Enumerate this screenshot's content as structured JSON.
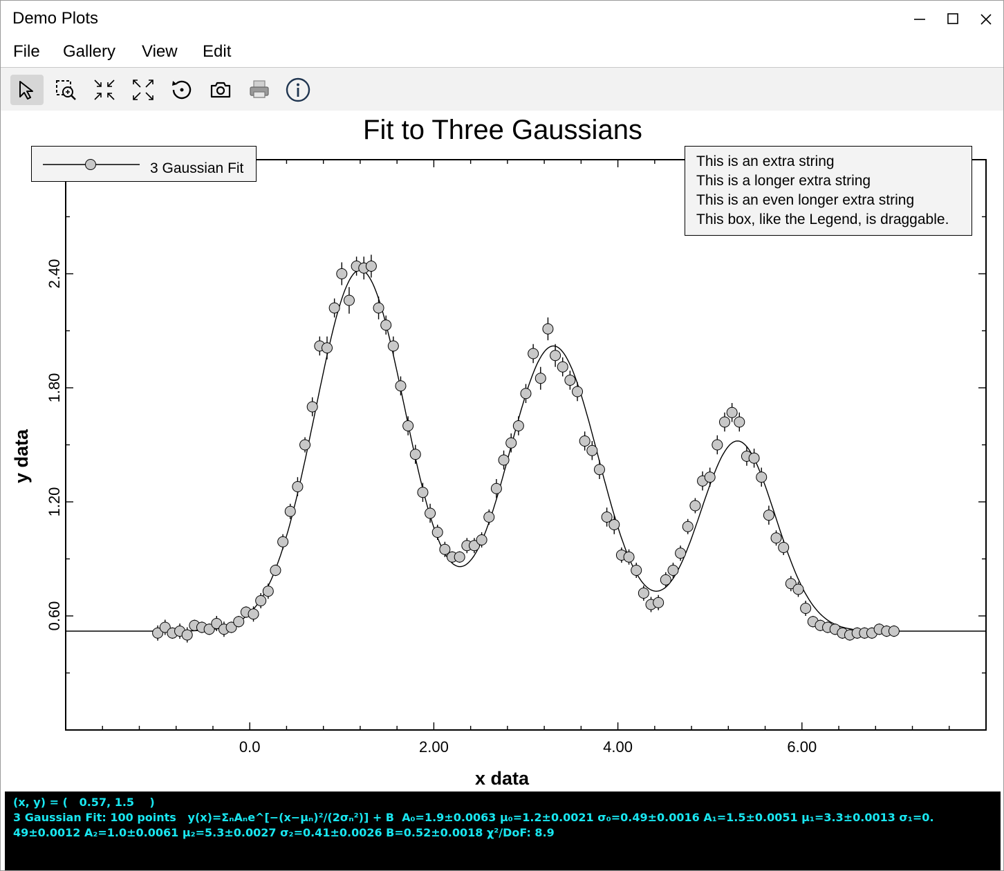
{
  "window": {
    "title": "Demo Plots",
    "controls": [
      "minimize",
      "maximize",
      "close"
    ]
  },
  "menu": [
    "File",
    "Gallery",
    "View",
    "Edit"
  ],
  "toolbar": [
    {
      "name": "select-tool",
      "icon": "cursor-arrow-icon",
      "active": true
    },
    {
      "name": "zoom-box-tool",
      "icon": "zoom-box-icon",
      "active": false
    },
    {
      "name": "zoom-in-tool",
      "icon": "arrows-inward-icon",
      "active": false
    },
    {
      "name": "zoom-out-tool",
      "icon": "arrows-outward-icon",
      "active": false
    },
    {
      "name": "reset-tool",
      "icon": "reset-rotate-icon",
      "active": false
    },
    {
      "name": "snapshot-tool",
      "icon": "camera-icon",
      "active": false
    },
    {
      "name": "print-tool",
      "icon": "printer-icon",
      "active": false
    },
    {
      "name": "info-tool",
      "icon": "info-icon",
      "active": false
    }
  ],
  "colors": {
    "marker_fill": "#c8c8c8",
    "status_bg": "#000000",
    "status_text": "#19e6f0",
    "legend_bg": "#f3f3f3"
  },
  "chart_data": {
    "type": "scatter",
    "title": "Fit to Three Gaussians",
    "xlabel": "x data",
    "ylabel": "y data",
    "xlim": [
      -2.0,
      8.0
    ],
    "ylim": [
      0.0,
      3.0
    ],
    "xticks": [
      0.0,
      2.0,
      4.0,
      6.0
    ],
    "xtick_labels": [
      "0.0",
      "2.00",
      "4.00",
      "6.00"
    ],
    "yticks": [
      0.6,
      1.2,
      1.8,
      2.4
    ],
    "ytick_labels": [
      "0.60",
      "1.20",
      "1.80",
      "2.40"
    ],
    "legend": {
      "position": "top-left",
      "entries": [
        "3 Gaussian Fit"
      ]
    },
    "extra_legend": [
      "This is an extra string",
      "This is a longer extra string",
      "This is an even longer extra string",
      "This box, like the Legend, is draggable."
    ],
    "series": [
      {
        "name": "3 Gaussian Fit",
        "marker": "circle",
        "x": [
          -1.0,
          -0.92,
          -0.84,
          -0.76,
          -0.68,
          -0.6,
          -0.52,
          -0.44,
          -0.36,
          -0.28,
          -0.2,
          -0.12,
          -0.04,
          0.04,
          0.12,
          0.2,
          0.28,
          0.36,
          0.44,
          0.52,
          0.6,
          0.68,
          0.76,
          0.84,
          0.92,
          1.0,
          1.08,
          1.16,
          1.24,
          1.32,
          1.4,
          1.48,
          1.56,
          1.64,
          1.72,
          1.8,
          1.88,
          1.96,
          2.04,
          2.12,
          2.2,
          2.28,
          2.36,
          2.44,
          2.52,
          2.6,
          2.68,
          2.76,
          2.84,
          2.92,
          3.0,
          3.08,
          3.16,
          3.24,
          3.32,
          3.4,
          3.48,
          3.56,
          3.64,
          3.72,
          3.8,
          3.88,
          3.96,
          4.04,
          4.12,
          4.2,
          4.28,
          4.36,
          4.44,
          4.52,
          4.6,
          4.68,
          4.76,
          4.84,
          4.92,
          5.0,
          5.08,
          5.16,
          5.24,
          5.32,
          5.4,
          5.48,
          5.56,
          5.64,
          5.72,
          5.8,
          5.88,
          5.96,
          6.04,
          6.12,
          6.2,
          6.28,
          6.36,
          6.44,
          6.52,
          6.6,
          6.68,
          6.76,
          6.84,
          6.92,
          7.0
        ],
        "y": [
          0.51,
          0.54,
          0.51,
          0.52,
          0.5,
          0.55,
          0.54,
          0.53,
          0.56,
          0.53,
          0.54,
          0.57,
          0.62,
          0.61,
          0.68,
          0.73,
          0.84,
          0.99,
          1.15,
          1.28,
          1.5,
          1.7,
          2.02,
          2.01,
          2.22,
          2.4,
          2.26,
          2.44,
          2.43,
          2.44,
          2.22,
          2.13,
          2.02,
          1.81,
          1.6,
          1.45,
          1.25,
          1.14,
          1.04,
          0.95,
          0.91,
          0.91,
          0.97,
          0.97,
          1.0,
          1.12,
          1.27,
          1.42,
          1.51,
          1.6,
          1.77,
          1.98,
          1.85,
          2.11,
          1.97,
          1.91,
          1.84,
          1.78,
          1.52,
          1.47,
          1.37,
          1.12,
          1.08,
          0.92,
          0.91,
          0.84,
          0.72,
          0.66,
          0.67,
          0.79,
          0.84,
          0.93,
          1.07,
          1.18,
          1.31,
          1.33,
          1.5,
          1.62,
          1.67,
          1.62,
          1.44,
          1.43,
          1.33,
          1.13,
          1.01,
          0.96,
          0.77,
          0.74,
          0.64,
          0.57,
          0.55,
          0.54,
          0.53,
          0.51,
          0.5,
          0.51,
          0.51,
          0.51,
          0.53,
          0.52,
          0.52
        ],
        "yerr": [
          0.04,
          0.04,
          0.03,
          0.04,
          0.04,
          0.03,
          0.03,
          0.03,
          0.04,
          0.04,
          0.03,
          0.03,
          0.03,
          0.04,
          0.04,
          0.04,
          0.03,
          0.04,
          0.04,
          0.05,
          0.04,
          0.05,
          0.05,
          0.06,
          0.05,
          0.06,
          0.07,
          0.05,
          0.06,
          0.06,
          0.06,
          0.05,
          0.05,
          0.05,
          0.05,
          0.05,
          0.05,
          0.05,
          0.04,
          0.04,
          0.03,
          0.03,
          0.04,
          0.04,
          0.04,
          0.04,
          0.05,
          0.05,
          0.05,
          0.05,
          0.05,
          0.05,
          0.06,
          0.06,
          0.06,
          0.05,
          0.05,
          0.05,
          0.05,
          0.05,
          0.05,
          0.05,
          0.05,
          0.04,
          0.04,
          0.04,
          0.04,
          0.04,
          0.04,
          0.04,
          0.04,
          0.04,
          0.04,
          0.04,
          0.05,
          0.05,
          0.05,
          0.05,
          0.05,
          0.05,
          0.05,
          0.05,
          0.05,
          0.05,
          0.04,
          0.04,
          0.04,
          0.04,
          0.04,
          0.03,
          0.03,
          0.03,
          0.03,
          0.03,
          0.03,
          0.03,
          0.03,
          0.03,
          0.03,
          0.03,
          0.03
        ]
      },
      {
        "name": "fit curve",
        "style": "line",
        "model": "three-gaussian",
        "params": {
          "A": [
            1.9,
            1.5,
            1.0
          ],
          "mu": [
            1.2,
            3.3,
            5.3
          ],
          "sigma": [
            0.49,
            0.49,
            0.41
          ],
          "B": 0.52
        }
      }
    ]
  },
  "status": {
    "line1": "(x, y) = (   0.57, 1.5    )",
    "line2": "3 Gaussian Fit: 100 points   y(x)=ΣₙAₙe^[−(x−μₙ)²/(2σₙ²)] + B  A₀=1.9±0.0063 μ₀=1.2±0.0021 σ₀=0.49±0.0016 A₁=1.5±0.0051 μ₁=3.3±0.0013 σ₁=0.",
    "line3": "49±0.0012 A₂=1.0±0.0061 μ₂=5.3±0.0027 σ₂=0.41±0.0026 B=0.52±0.0018 χ²/DoF: 8.9"
  }
}
